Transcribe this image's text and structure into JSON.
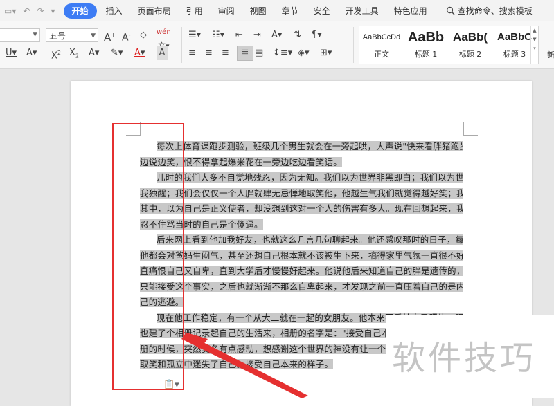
{
  "menubar": {
    "tabs": [
      {
        "label": "开始",
        "active": true
      },
      {
        "label": "插入"
      },
      {
        "label": "页面布局"
      },
      {
        "label": "引用"
      },
      {
        "label": "审阅"
      },
      {
        "label": "视图"
      },
      {
        "label": "章节"
      },
      {
        "label": "安全"
      },
      {
        "label": "开发工具"
      },
      {
        "label": "特色应用"
      }
    ],
    "search_label": "查找命令、搜索模板"
  },
  "ribbon": {
    "font_size_value": "五号",
    "styles": [
      {
        "preview": "AaBbCcDd",
        "name": "正文"
      },
      {
        "preview": "AaBb",
        "name": "标题 1"
      },
      {
        "preview": "AaBb(",
        "name": "标题 2"
      },
      {
        "preview": "AaBbC",
        "name": "标题 3"
      }
    ],
    "new_style_label": "新"
  },
  "document": {
    "lines": [
      {
        "text": "每次上体育课跑步测验，班级几个男生就会在一旁起哄，大声说\"快来看胖猪跑步咯\"，",
        "indent": true
      },
      {
        "text": "边说边笑，恨不得拿起爆米花在一旁边吃边看笑话。"
      },
      {
        "text": "儿时的我们大多不自觉地残忍，因为无知。我们以为世界非黑即白；我们以为世人皆醉",
        "indent": true
      },
      {
        "text": "我独醒；我们会仅仅一个人胖就肆无忌惮地取笑他，他越生气我们就觉得越好笑；我们陶醉"
      },
      {
        "text": "其中，以为自己是正义使者，却没想到这对一个人的伤害有多大。现在回想起来，我还是会"
      },
      {
        "text": "忍不住骂当时的自己是个傻逼。"
      },
      {
        "text": "后来网上看到他加我好友，也就这么几言几句聊起来。他还感叹那时的日子，每次回家",
        "indent": true
      },
      {
        "text": "他都会对爸妈生闷气，甚至还想自己根本就不该被生下来，搞得家里气氛一直很不好。他一"
      },
      {
        "text": "直痛恨自己又自卑，直到大学后才慢慢好起来。他说他后来知道自己的胖是遗传的，没办法"
      },
      {
        "text": "只能接受这个事实，之后也就渐渐不那么自卑起来，才发现之前一直压着自己的是内心对自"
      },
      {
        "text": "己的逃避。"
      },
      {
        "text": "现在他工作稳定，有一个从大二就在一起的女朋友。他本来不爱拍自己照片，现在倒",
        "indent": true
      },
      {
        "text": "也建了个相册记录起自己的生活来，相册的名字是：\"接受自己本来的样子\"。"
      },
      {
        "text": "册的时候，突然莫名有点感动，想感谢这个世界的神没有让一个大好少年"
      },
      {
        "text": "取笑和孤立中迷失了自己。接受自己本来的样子。"
      }
    ]
  },
  "watermark": "软件技巧"
}
